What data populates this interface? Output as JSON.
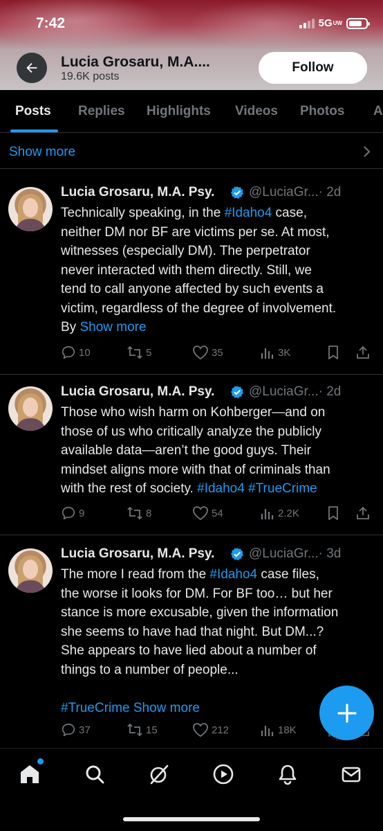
{
  "status_bar": {
    "time": "7:42",
    "network": "5G",
    "network_suffix": "UW"
  },
  "header": {
    "profile_name": "Lucia Grosaru, M.A....",
    "post_count": "19.6K posts",
    "follow_label": "Follow"
  },
  "tabs": [
    {
      "label": "Posts",
      "active": true
    },
    {
      "label": "Replies"
    },
    {
      "label": "Highlights"
    },
    {
      "label": "Videos"
    },
    {
      "label": "Photos"
    },
    {
      "label": "A"
    }
  ],
  "show_more_row": {
    "label": "Show more"
  },
  "posts": [
    {
      "author": "Lucia Grosaru, M.A. Psy.",
      "handle": "@LuciaGr...",
      "time": "· 2d",
      "lines": [
        [
          "Technically speaking, in the ",
          "#Idaho4",
          " case,"
        ],
        [
          "neither DM nor BF are victims per se. At most,"
        ],
        [
          "witnesses (especially DM). The perpetrator"
        ],
        [
          "never interacted with them directly. Still, we"
        ],
        [
          "tend to call anyone affected by such events a"
        ],
        [
          "victim, regardless of the degree of involvement."
        ],
        [
          "By ",
          "Show more"
        ]
      ],
      "replies": "10",
      "reposts": "5",
      "likes": "35",
      "views": "3K"
    },
    {
      "author": "Lucia Grosaru, M.A. Psy.",
      "handle": "@LuciaGr...",
      "time": "· 2d",
      "lines": [
        [
          "Those who wish harm on Kohberger—and on"
        ],
        [
          "those of us who critically analyze the publicly"
        ],
        [
          "available data—aren’t the good guys. Their"
        ],
        [
          "mindset aligns more with that of criminals than"
        ],
        [
          "with the rest of society. ",
          "#Idaho4 #TrueCrime"
        ]
      ],
      "replies": "9",
      "reposts": "8",
      "likes": "54",
      "views": "2.2K"
    },
    {
      "author": "Lucia Grosaru, M.A. Psy.",
      "handle": "@LuciaGr...",
      "time": "· 3d",
      "lines": [
        [
          "The more I read from the ",
          "#Idaho4",
          " case files,"
        ],
        [
          "the worse it looks for DM. For BF too… but her"
        ],
        [
          "stance is more excusable, given the information"
        ],
        [
          "she seems to have had that night. But DM...?"
        ],
        [
          "She appears to have lied about a number of"
        ],
        [
          "things to a number of people..."
        ],
        [
          ""
        ],
        [
          "",
          "#TrueCrime Show more"
        ]
      ],
      "replies": "37",
      "reposts": "15",
      "likes": "212",
      "views": "18K"
    }
  ],
  "colors": {
    "accent": "#1d9bf0",
    "background": "#000000",
    "muted": "#71767b",
    "text": "#e7e9ea"
  },
  "bottom_nav": [
    "home-icon",
    "search-icon",
    "grok-icon",
    "video-icon",
    "notifications-icon",
    "messages-icon"
  ]
}
